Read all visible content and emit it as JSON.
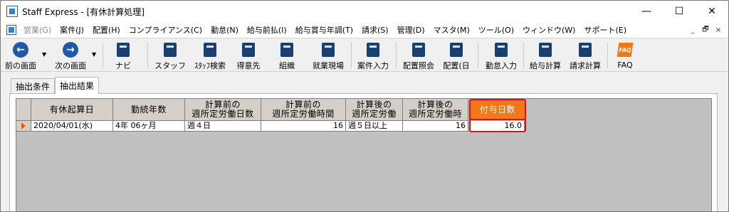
{
  "window": {
    "title": "Staff Express - [有休計算処理]",
    "controls": {
      "minimize": "—",
      "maximize": "☐",
      "close": "✕"
    }
  },
  "menu": {
    "items": [
      {
        "label": "営業(G)",
        "disabled": true
      },
      {
        "label": "案件(J)",
        "disabled": false
      },
      {
        "label": "配置(H)",
        "disabled": false
      },
      {
        "label": "コンプライアンス(C)",
        "disabled": false
      },
      {
        "label": "勤怠(N)",
        "disabled": false
      },
      {
        "label": "給与前払(I)",
        "disabled": false
      },
      {
        "label": "給与賞与年調(T)",
        "disabled": false
      },
      {
        "label": "請求(S)",
        "disabled": false
      },
      {
        "label": "管理(D)",
        "disabled": false
      },
      {
        "label": "マスタ(M)",
        "disabled": false
      },
      {
        "label": "ツール(O)",
        "disabled": false
      },
      {
        "label": "ウィンドウ(W)",
        "disabled": false
      },
      {
        "label": "サポート(E)",
        "disabled": false
      }
    ],
    "mdi": {
      "minimize": "_",
      "restore": "🗗",
      "close": "×"
    }
  },
  "toolbar": {
    "items": [
      {
        "id": "prev",
        "label": "前の画面",
        "icon": "arrow-left-icon"
      },
      {
        "id": "next",
        "label": "次の画面",
        "icon": "arrow-right-icon"
      },
      {
        "id": "navi",
        "label": "ナビ",
        "icon": "keyboard-icon"
      },
      {
        "id": "staff",
        "label": "スタッフ",
        "icon": "staff-icon"
      },
      {
        "id": "staff-search",
        "label": "ｽﾀｯﾌ検索",
        "icon": "staff-search-icon"
      },
      {
        "id": "client",
        "label": "得意先",
        "icon": "client-icon"
      },
      {
        "id": "org",
        "label": "組織",
        "icon": "organization-icon"
      },
      {
        "id": "site",
        "label": "就業現場",
        "icon": "worksite-icon"
      },
      {
        "id": "case-input",
        "label": "案件入力",
        "icon": "case-input-icon"
      },
      {
        "id": "placement-query",
        "label": "配置照会",
        "icon": "placement-query-icon"
      },
      {
        "id": "placement-day",
        "label": "配置(日",
        "icon": "placement-day-icon"
      },
      {
        "id": "attendance",
        "label": "勤怠入力",
        "icon": "attendance-icon"
      },
      {
        "id": "payroll",
        "label": "給与計算",
        "icon": "payroll-icon"
      },
      {
        "id": "billing",
        "label": "請求計算",
        "icon": "billing-icon"
      },
      {
        "id": "faq",
        "label": "FAQ",
        "icon": "faq-icon"
      }
    ]
  },
  "tabs": [
    {
      "label": "抽出条件",
      "active": false
    },
    {
      "label": "抽出結果",
      "active": true
    }
  ],
  "grid": {
    "headers": [
      {
        "lines": [
          "有休起算日"
        ]
      },
      {
        "lines": [
          "勤続年数"
        ]
      },
      {
        "lines": [
          "計算前の",
          "週所定労働日数"
        ]
      },
      {
        "lines": [
          "計算前の",
          "週所定労働時間"
        ]
      },
      {
        "lines": [
          "計算後の",
          "週所定労働"
        ]
      },
      {
        "lines": [
          "計算後の",
          "週所定労働時"
        ]
      },
      {
        "lines": [
          "付与日数"
        ],
        "highlight": true
      }
    ],
    "rows": [
      [
        "2020/04/01(水)",
        "4年 06ヶ月",
        "週４日",
        "16",
        "週５日以上",
        "16",
        "16.0"
      ]
    ]
  },
  "colors": {
    "highlight_header": "#f07818",
    "highlight_border": "#e0101a",
    "row_marker": "#e06000"
  }
}
